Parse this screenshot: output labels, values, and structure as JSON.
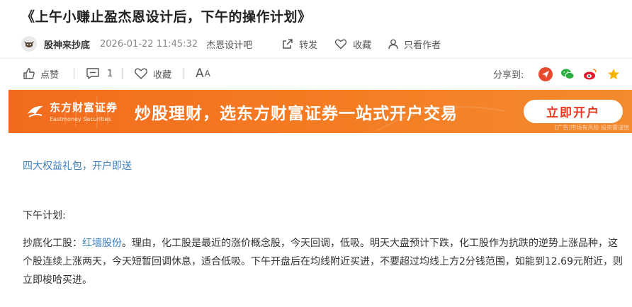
{
  "post": {
    "title": "《上午小赚止盈杰恩设计后，下午的操作计划》",
    "author": "股神来抄底",
    "datetime": "2026-01-22 11:45:32",
    "forum": "杰恩设计吧",
    "actions": {
      "repost": "转发",
      "favorite": "收藏",
      "author_only": "只看作者"
    }
  },
  "toolbar": {
    "like": "点赞",
    "comment_count": "1",
    "favorite": "收藏",
    "font_size_big": "A",
    "font_size_small": "A",
    "share_label": "分享到:",
    "share_icons": [
      "toutiao-icon",
      "wechat-icon",
      "weibo-icon",
      "star-icon"
    ]
  },
  "banner": {
    "logo_cn": "东方财富证券",
    "logo_en": "Eastmoney Securities",
    "slogan": "炒股理财，选东方财富证券一站式开户交易",
    "button": "立即开户",
    "ad_note": "[广告]市场有风险 投资需谨慎"
  },
  "content": {
    "promo_link": "四大权益礼包，开户即送",
    "section_title": "下午计划:",
    "para_prefix": "抄底化工股：",
    "stock_name": "红墙股份",
    "para_body": "。理由，化工股是最近的涨价概念股，今天回调，低吸。明天大盘预计下跌，化工股作为抗跌的逆势上涨品种，这个股连续上涨两天，今天短暂回调休息，适合低吸。下午开盘后在均线附近买进，不要超过均线上方2分钱范围，如能到12.69元附近，则立即梭哈买进。"
  },
  "colors": {
    "link": "#3a7fc2",
    "banner_orange": "#f26b1d",
    "banner_button_text": "#e8381f"
  }
}
